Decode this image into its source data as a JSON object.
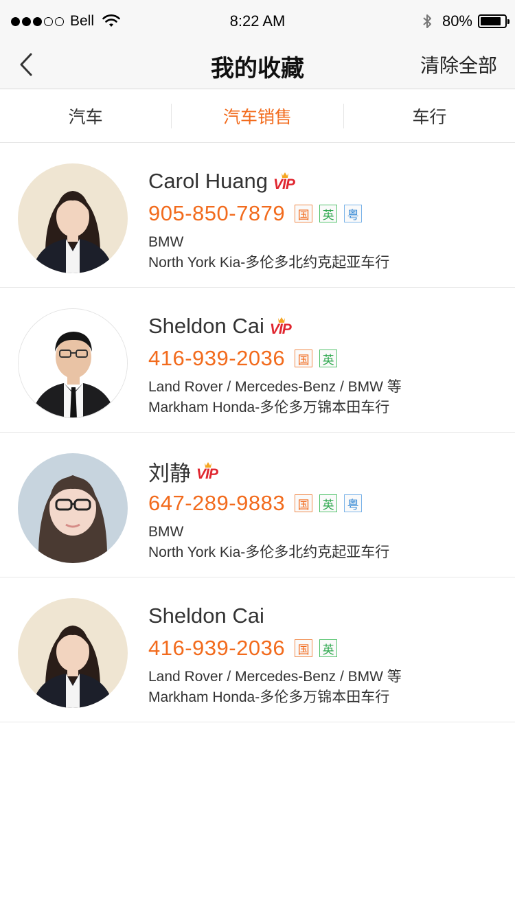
{
  "status_bar": {
    "carrier": "Bell",
    "time": "8:22 AM",
    "battery": "80%",
    "signal_filled": 3,
    "signal_total": 5
  },
  "nav": {
    "title": "我的收藏",
    "clear_all": "清除全部",
    "back_icon": "chevron-left-icon"
  },
  "tabs": [
    {
      "label": "汽车",
      "active": false
    },
    {
      "label": "汽车销售",
      "active": true
    },
    {
      "label": "车行",
      "active": false
    }
  ],
  "colors": {
    "accent": "#f26b1d",
    "vip": "#e0262f",
    "crown": "#f5a623",
    "lang_guo": "#f26b1d",
    "lang_ying": "#2fa84f",
    "lang_yue": "#3a8bd6"
  },
  "contacts": [
    {
      "name": "Carol Huang",
      "vip": true,
      "vip_label": "VIP",
      "phone": "905-850-7879",
      "langs": [
        "国",
        "英",
        "粤"
      ],
      "brands": "BMW",
      "dealer": "North York Kia-多伦多北约克起亚车行",
      "avatar": "woman-avatar"
    },
    {
      "name": "Sheldon Cai",
      "vip": true,
      "vip_label": "VIP",
      "phone": "416-939-2036",
      "langs": [
        "国",
        "英"
      ],
      "brands": "Land Rover / Mercedes-Benz / BMW 等",
      "dealer": "Markham Honda-多伦多万锦本田车行",
      "avatar": "man-avatar"
    },
    {
      "name": "刘静",
      "vip": true,
      "vip_label": "VIP",
      "phone": "647-289-9883",
      "langs": [
        "国",
        "英",
        "粤"
      ],
      "brands": "BMW",
      "dealer": "North York Kia-多伦多北约克起亚车行",
      "avatar": "woman-glasses-avatar"
    },
    {
      "name": "Sheldon Cai",
      "vip": false,
      "vip_label": "",
      "phone": "416-939-2036",
      "langs": [
        "国",
        "英"
      ],
      "brands": "Land Rover / Mercedes-Benz / BMW 等",
      "dealer": "Markham Honda-多伦多万锦本田车行",
      "avatar": "woman-avatar"
    }
  ]
}
